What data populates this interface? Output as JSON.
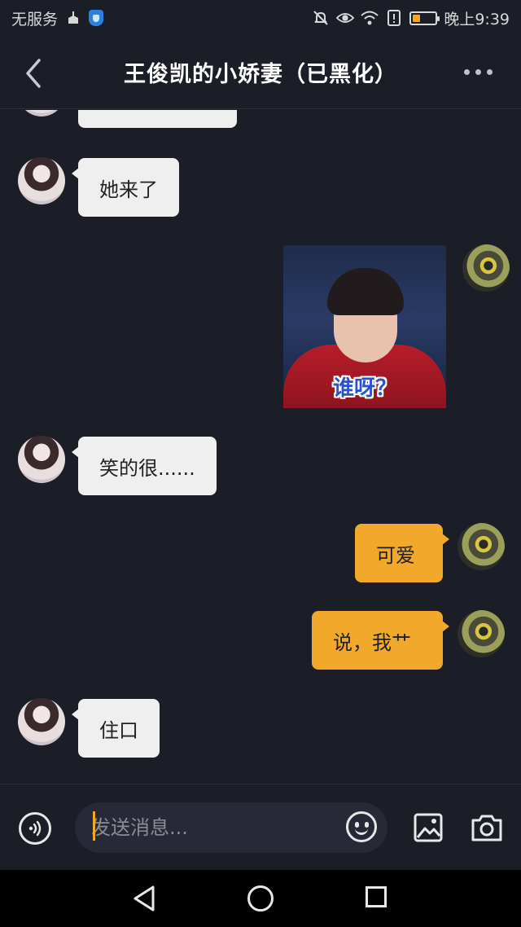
{
  "status_bar": {
    "carrier": "无服务",
    "time": "晚上9:39",
    "battery_level": 0.3,
    "icons": [
      "cleaner-icon",
      "shield-icon",
      "mute-icon",
      "eye-icon",
      "wifi-icon",
      "alert-icon",
      "battery-icon"
    ]
  },
  "header": {
    "title": "王俊凯的小娇妻（已黑化）",
    "back_icon": "chevron-left-icon",
    "more_icon": "more-dots-icon"
  },
  "messages": [
    {
      "side": "in",
      "type": "text",
      "text": ""
    },
    {
      "side": "in",
      "type": "text",
      "text": "她来了"
    },
    {
      "side": "out",
      "type": "image",
      "caption": "谁呀？"
    },
    {
      "side": "in",
      "type": "text",
      "text": "笑的很......"
    },
    {
      "side": "out",
      "type": "text",
      "text": "可爱"
    },
    {
      "side": "out",
      "type": "text",
      "text": "说，我艹"
    },
    {
      "side": "in",
      "type": "text",
      "text": "住口"
    }
  ],
  "composer": {
    "placeholder": "发送消息...",
    "value": "",
    "icons": [
      "voice-icon",
      "emoji-icon",
      "image-icon",
      "camera-icon"
    ]
  },
  "nav_bar": {
    "icons": [
      "nav-back-icon",
      "nav-home-icon",
      "nav-recents-icon"
    ]
  },
  "colors": {
    "background": "#1b1e27",
    "incoming_bubble": "#efefef",
    "outgoing_bubble": "#f2a92b",
    "accent": "#f2a92b"
  }
}
